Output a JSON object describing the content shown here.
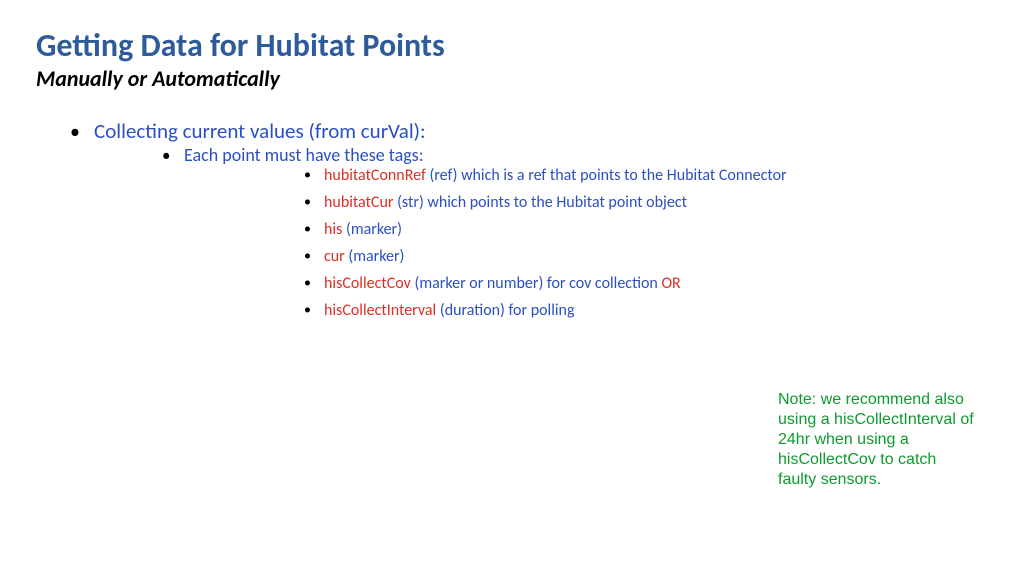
{
  "header": {
    "title": "Getting Data for Hubitat Points",
    "subtitle": "Manually or Automatically"
  },
  "body": {
    "l1": "Collecting current values (from curVal):",
    "l2": "Each point must have these tags:",
    "items": [
      {
        "tag": "hubitatConnRef",
        "rest": " (ref) which is a ref that points to the Hubitat Connector",
        "or": ""
      },
      {
        "tag": "hubitatCur",
        "rest": " (str) which points to the Hubitat point object",
        "or": ""
      },
      {
        "tag": "his",
        "rest": " (marker)",
        "or": ""
      },
      {
        "tag": "cur",
        "rest": " (marker)",
        "or": ""
      },
      {
        "tag": "hisCollectCov",
        "rest": " (marker or number) for cov collection ",
        "or": "OR"
      },
      {
        "tag": "hisCollectInterval",
        "rest": " (duration) for polling",
        "or": ""
      }
    ]
  },
  "note": "Note: we recommend also using a hisCollectInterval of 24hr when using a hisCollectCov to catch faulty sensors."
}
